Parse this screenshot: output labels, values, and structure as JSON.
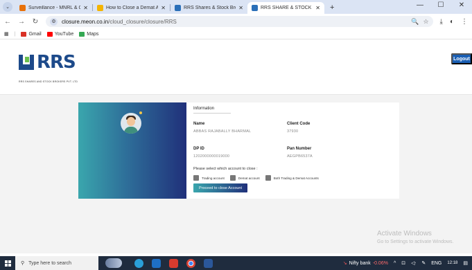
{
  "browser": {
    "tabs": [
      {
        "title": "Surveillance - MNRL & Online",
        "color": "#e8710a",
        "active": false
      },
      {
        "title": "How to Close a Demat Account",
        "color": "#f4b400",
        "active": false
      },
      {
        "title": "RRS Shares & Stock Brokers Pvt",
        "color": "#2a6fb8",
        "active": false
      },
      {
        "title": "RRS SHARE & STOCK BROKERS",
        "color": "#2a6fb8",
        "active": true
      }
    ],
    "url_host": "closure.meon.co.in",
    "url_path": "/cloud_closure/closure/RRS",
    "bookmarks": [
      {
        "label": "Gmail",
        "color": "#d93025"
      },
      {
        "label": "YouTube",
        "color": "#ff0000"
      },
      {
        "label": "Maps",
        "color": "#34a853"
      }
    ]
  },
  "header": {
    "logo_text": "RRS",
    "logo_subtitle": "RRS SHARES AND STOCK BROKERS PVT. LTD",
    "logout_label": "Logout"
  },
  "card": {
    "section_title": "Information",
    "name_label": "Name",
    "name_value": "ABBAS RAJABALLY BHARMAL",
    "client_code_label": "Client Code",
    "client_code_value": "37930",
    "dp_id_label": "DP ID",
    "dp_id_value": "1202000000019000",
    "pan_label": "Pan Number",
    "pan_value": "AEGPB6537A",
    "prompt": "Please select which account to close :",
    "options": [
      "Trading account",
      "Demat account",
      "Both Trading & Demat Accounts"
    ],
    "proceed_label": "Proceed to close Account"
  },
  "watermark": {
    "line1": "Activate Windows",
    "line2": "Go to Settings to activate Windows."
  },
  "taskbar": {
    "search_placeholder": "Type here to search",
    "ticker_name": "Nifty bank",
    "ticker_change": "-0.06%",
    "language": "ENG",
    "time": "12:18"
  }
}
